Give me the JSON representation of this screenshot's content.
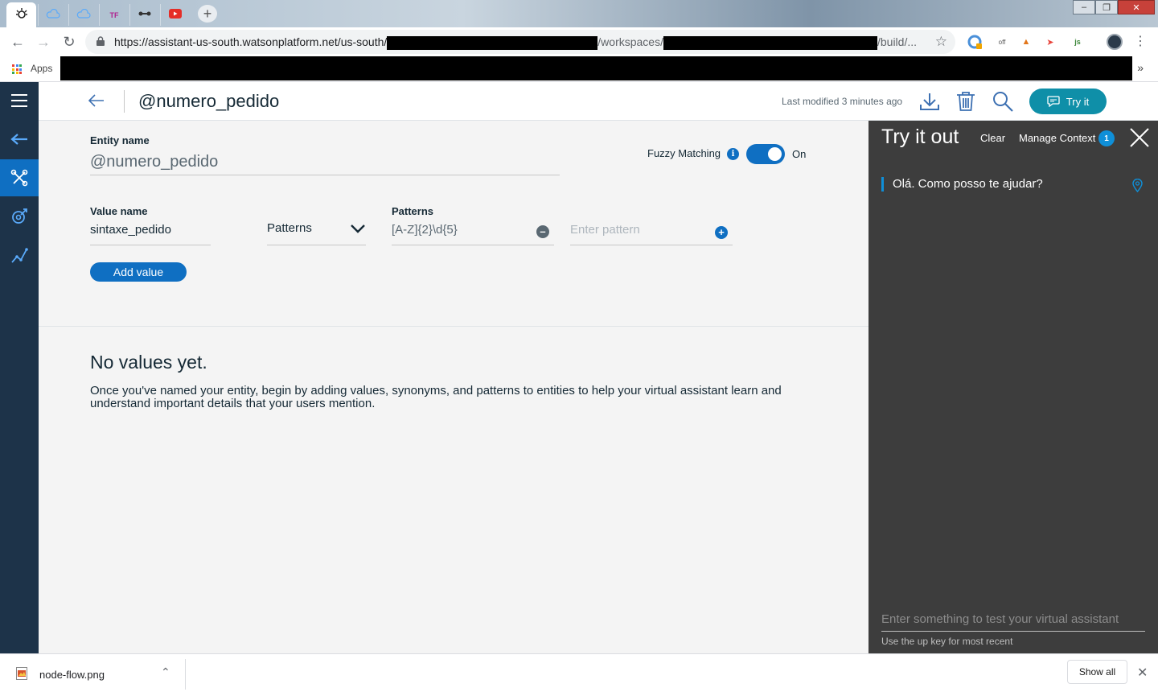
{
  "browser": {
    "url_prefix": "https://assistant-us-south.watsonplatform.net/us-south/",
    "url_mid": "/workspaces/",
    "url_end": "/build/...",
    "bookmarks_apps_label": "Apps"
  },
  "header": {
    "title": "@numero_pedido",
    "last_modified": "Last modified 3 minutes ago",
    "try_it_label": "Try it"
  },
  "entity": {
    "name_label": "Entity name",
    "name_value": "@numero_pedido",
    "fuzzy_label": "Fuzzy Matching",
    "fuzzy_state": "On"
  },
  "value_row": {
    "value_name_label": "Value name",
    "value_name": "sintaxe_pedido",
    "type_selected": "Patterns",
    "patterns_label": "Patterns",
    "pattern_value": "[A-Z]{2}\\d{5}",
    "pattern_placeholder": "Enter pattern",
    "add_value_label": "Add value"
  },
  "empty_state": {
    "title": "No values yet.",
    "description": "Once you've named your entity, begin by adding values, synonyms, and patterns to entities to help your virtual assistant learn and understand important details that your users mention."
  },
  "try_panel": {
    "title": "Try it out",
    "clear_label": "Clear",
    "manage_context_label": "Manage Context",
    "context_count": "1",
    "message": "Olá. Como posso te ajudar?",
    "input_placeholder": "Enter something to test your virtual assistant",
    "hint": "Use the up key for most recent"
  },
  "download_bar": {
    "file_name": "node-flow.png",
    "show_all_label": "Show all"
  },
  "colors": {
    "primary": "#0f6fc2",
    "nav_bg": "#1d3349",
    "panel_bg": "#3d3d3d",
    "try_button": "#0f8fa8"
  }
}
